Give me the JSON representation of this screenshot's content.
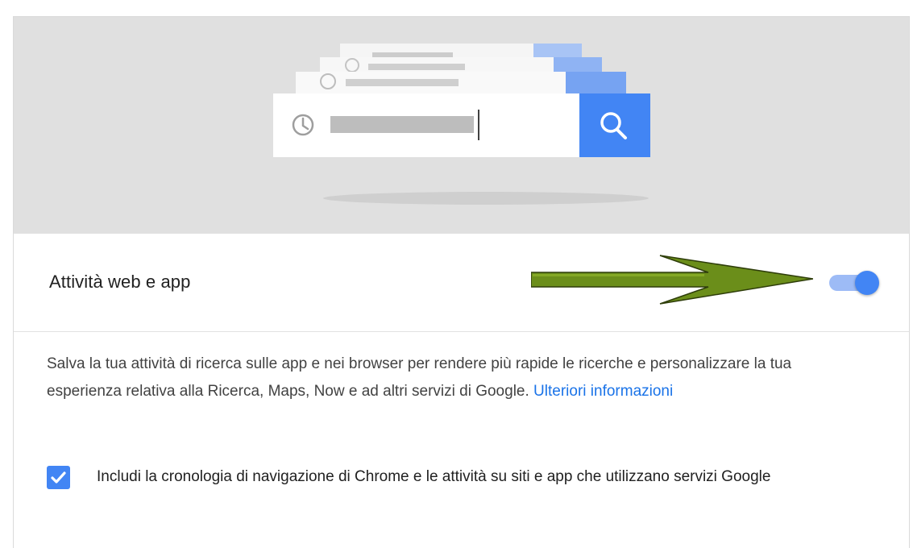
{
  "setting": {
    "title": "Attività web e app",
    "enabled": true
  },
  "description": {
    "text": "Salva la tua attività di ricerca sulle app e nei browser per rendere più rapide le ricerche e personalizzare la tua esperienza relativa alla Ricerca, Maps, Now e ad altri servizi di Google. ",
    "link_label": "Ulteriori informazioni"
  },
  "option": {
    "label": "Includi la cronologia di navigazione di Chrome e le attività su siti e app che utilizzano servizi Google",
    "checked": true
  },
  "icons": {
    "history": "clock-icon",
    "search": "search-icon",
    "check": "checkmark-icon",
    "annotation": "green-arrow-icon"
  },
  "colors": {
    "accent": "#4285f4",
    "accent_light": "#9dbbf6",
    "link": "#1a73e8",
    "hero_bg": "#e0e0e0",
    "arrow": "#6b8e1a"
  }
}
